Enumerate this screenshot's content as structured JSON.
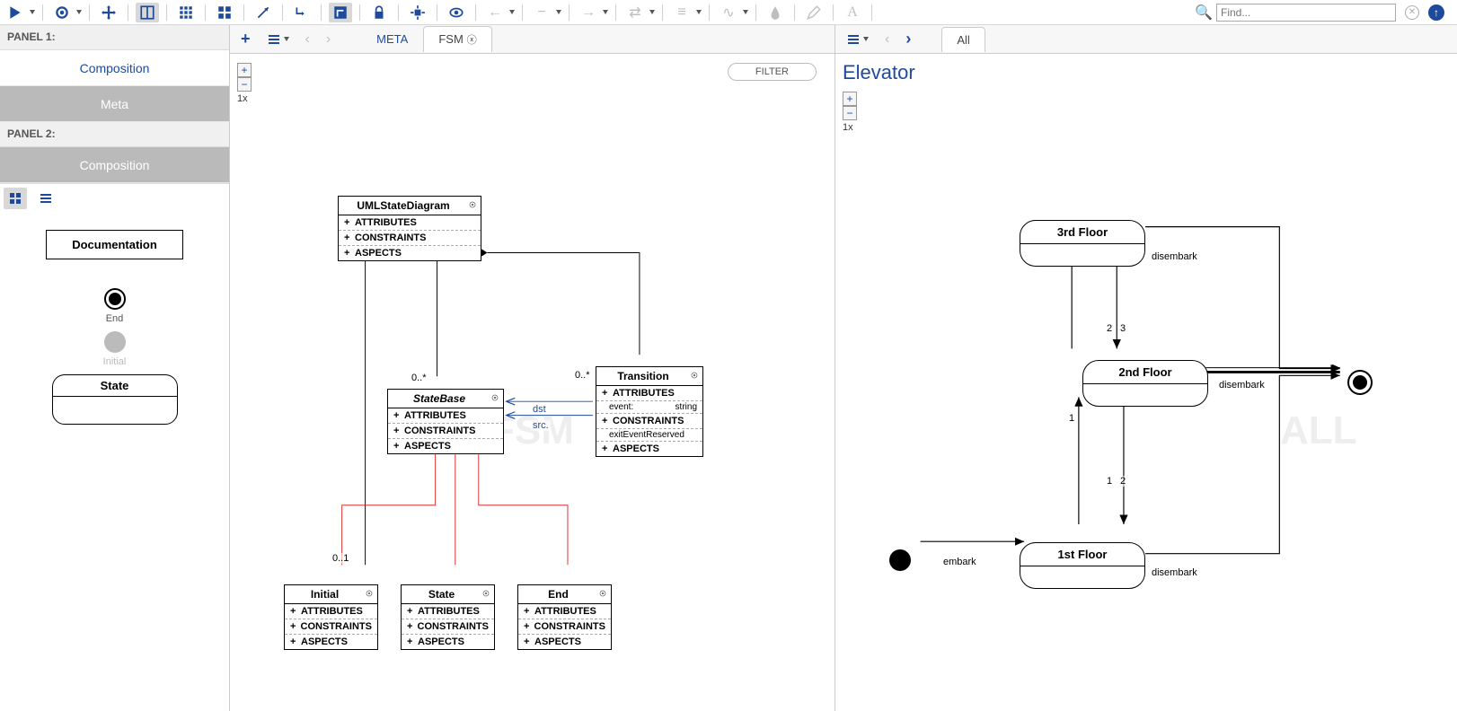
{
  "toolbar": {
    "find_placeholder": "Find..."
  },
  "leftPanel": {
    "panel1_label": "PANEL 1:",
    "panel2_label": "PANEL 2:",
    "items1": {
      "composition": "Composition",
      "meta": "Meta"
    },
    "items2": {
      "composition": "Composition"
    }
  },
  "palette": {
    "documentation": "Documentation",
    "end": "End",
    "initial": "Initial",
    "state": "State"
  },
  "center": {
    "tabs": {
      "meta": "META",
      "fsm": "FSM"
    },
    "zoom": "1x",
    "filter": "FILTER",
    "watermark": "FSM",
    "conn_labels": {
      "dst": "dst",
      "src": "src.",
      "c01": "0..1",
      "c0star_a": "0..*",
      "c0star_b": "0..*"
    },
    "boxes": {
      "umlStateDiagram": {
        "title": "UMLStateDiagram",
        "attributes": "ATTRIBUTES",
        "constraints": "CONSTRAINTS",
        "aspects": "ASPECTS"
      },
      "stateBase": {
        "title": "StateBase",
        "attributes": "ATTRIBUTES",
        "constraints": "CONSTRAINTS",
        "aspects": "ASPECTS"
      },
      "transition": {
        "title": "Transition",
        "attributes": "ATTRIBUTES",
        "event_k": "event:",
        "event_v": "string",
        "constraints": "CONSTRAINTS",
        "exit": "exitEventReserved",
        "aspects": "ASPECTS"
      },
      "initial": {
        "title": "Initial",
        "attributes": "ATTRIBUTES",
        "constraints": "CONSTRAINTS",
        "aspects": "ASPECTS"
      },
      "state": {
        "title": "State",
        "attributes": "ATTRIBUTES",
        "constraints": "CONSTRAINTS",
        "aspects": "ASPECTS"
      },
      "end": {
        "title": "End",
        "attributes": "ATTRIBUTES",
        "constraints": "CONSTRAINTS",
        "aspects": "ASPECTS"
      }
    }
  },
  "right": {
    "tab_all": "All",
    "title": "Elevator",
    "zoom": "1x",
    "watermark": "ALL",
    "nodes": {
      "floor3": "3rd Floor",
      "floor2": "2nd Floor",
      "floor1": "1st Floor"
    },
    "labels": {
      "embark": "embark",
      "disembark1": "disembark",
      "disembark2": "disembark",
      "disembark3": "disembark",
      "n1a": "1",
      "n2a": "2",
      "n2b": "2",
      "n3": "3",
      "n1b": "1"
    }
  }
}
